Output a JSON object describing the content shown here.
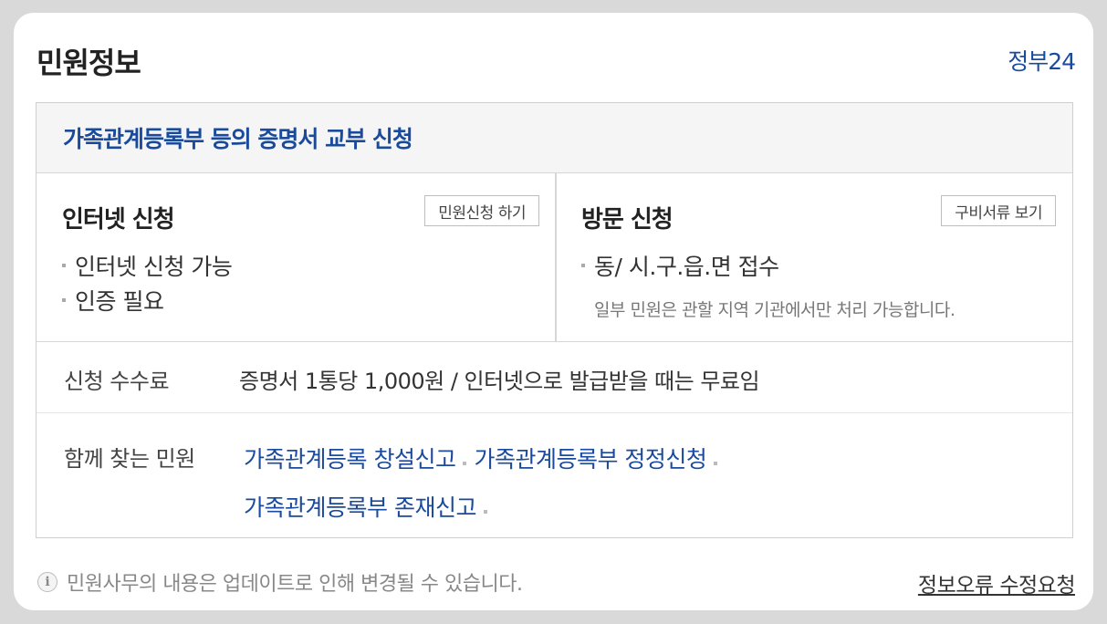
{
  "header": {
    "title": "민원정보",
    "link": "정부24"
  },
  "service": {
    "title": "가족관계등록부 등의 증명서 교부 신청"
  },
  "internet": {
    "title": "인터넷 신청",
    "button": "민원신청 하기",
    "items": [
      "인터넷 신청 가능",
      "인증 필요"
    ]
  },
  "visit": {
    "title": "방문 신청",
    "button": "구비서류 보기",
    "items": [
      "동/ 시.구.읍.면 접수"
    ],
    "note": "일부 민원은 관할 지역 기관에서만 처리 가능합니다."
  },
  "fee": {
    "label": "신청 수수료",
    "value": "증명서 1통당 1,000원 / 인터넷으로 발급받을 때는 무료임"
  },
  "related": {
    "label": "함께 찾는 민원",
    "links": [
      "가족관계등록 창설신고",
      "가족관계등록부 정정신청",
      "가족관계등록부 존재신고"
    ]
  },
  "footer": {
    "notice": "민원사무의 내용은 업데이트로 인해 변경될 수 있습니다.",
    "report_link": "정보오류 수정요청",
    "icon": "info-icon"
  },
  "colors": {
    "accent": "#1a4a9c",
    "background": "#d9d9d9"
  }
}
